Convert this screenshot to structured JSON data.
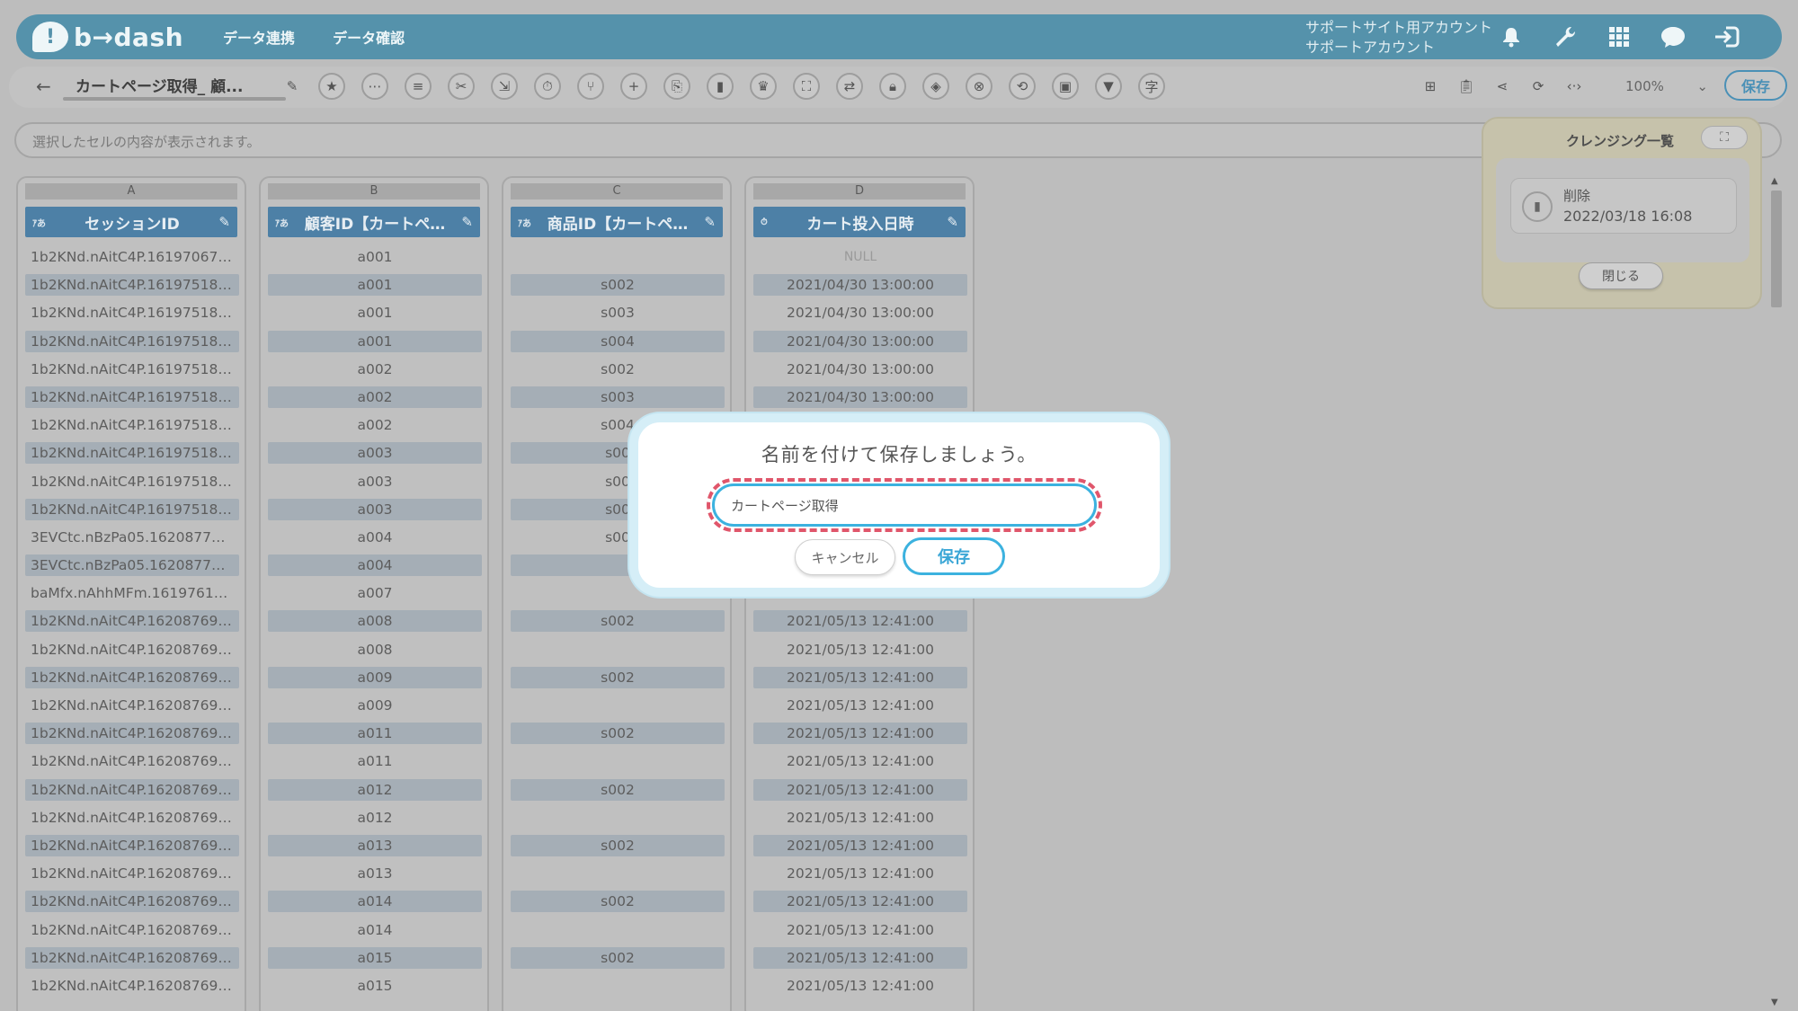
{
  "header": {
    "logo_text": "b→dash",
    "nav": [
      "データ連携",
      "データ確認"
    ],
    "account_line1": "サポートサイト用アカウント",
    "account_line2": "サポートアカウント",
    "brand_color": "#5592ab"
  },
  "toolbar": {
    "title": "カートページ取得_ 顧...",
    "zoom": "100%",
    "save_label": "保存"
  },
  "cell_bar": {
    "placeholder": "選択したセルの内容が表示されます。"
  },
  "columns": [
    {
      "letter": "A",
      "type": "ｱあ",
      "title": "セッションID",
      "cells": [
        "1b2KNd.nAitC4P.161970677...",
        "1b2KNd.nAitC4P.161975180...",
        "1b2KNd.nAitC4P.161975180...",
        "1b2KNd.nAitC4P.161975180...",
        "1b2KNd.nAitC4P.161975180...",
        "1b2KNd.nAitC4P.161975180...",
        "1b2KNd.nAitC4P.161975180...",
        "1b2KNd.nAitC4P.161975180...",
        "1b2KNd.nAitC4P.161975180...",
        "1b2KNd.nAitC4P.161975180...",
        "3EVCtc.nBzPa05.162087702...",
        "3EVCtc.nBzPa05.162087702...",
        "baMfx.nAhhMFm.161976133...",
        "1b2KNd.nAitC4P.162087690...",
        "1b2KNd.nAitC4P.162087690...",
        "1b2KNd.nAitC4P.162087690...",
        "1b2KNd.nAitC4P.162087690...",
        "1b2KNd.nAitC4P.162087690...",
        "1b2KNd.nAitC4P.162087690...",
        "1b2KNd.nAitC4P.162087690...",
        "1b2KNd.nAitC4P.162087690...",
        "1b2KNd.nAitC4P.162087690...",
        "1b2KNd.nAitC4P.162087690...",
        "1b2KNd.nAitC4P.162087690...",
        "1b2KNd.nAitC4P.162087690...",
        "1b2KNd.nAitC4P.162087690...",
        "1b2KNd.nAitC4P.162087690..."
      ]
    },
    {
      "letter": "B",
      "type": "ｱあ",
      "title": "顧客ID【カートペ…",
      "cells": [
        "a001",
        "a001",
        "a001",
        "a001",
        "a002",
        "a002",
        "a002",
        "a003",
        "a003",
        "a003",
        "a004",
        "a004",
        "a007",
        "a008",
        "a008",
        "a009",
        "a009",
        "a011",
        "a011",
        "a012",
        "a012",
        "a013",
        "a013",
        "a014",
        "a014",
        "a015",
        "a015"
      ]
    },
    {
      "letter": "C",
      "type": "ｱあ",
      "title": "商品ID【カートペ…",
      "cells": [
        "",
        "s002",
        "s003",
        "s004",
        "s002",
        "s003",
        "s004",
        "s00",
        "s00",
        "s00",
        "s00",
        "",
        "",
        "s002",
        "",
        "s002",
        "",
        "s002",
        "",
        "s002",
        "",
        "s002",
        "",
        "s002",
        "",
        "s002",
        ""
      ]
    },
    {
      "letter": "D",
      "type": "⏱",
      "title": "カート投入日時",
      "cells": [
        "NULL",
        "2021/04/30 13:00:00",
        "2021/04/30 13:00:00",
        "2021/04/30 13:00:00",
        "2021/04/30 13:00:00",
        "2021/04/30 13:00:00",
        "",
        "",
        "",
        "",
        "",
        "",
        "",
        "2021/05/13 12:41:00",
        "2021/05/13 12:41:00",
        "2021/05/13 12:41:00",
        "2021/05/13 12:41:00",
        "2021/05/13 12:41:00",
        "2021/05/13 12:41:00",
        "2021/05/13 12:41:00",
        "2021/05/13 12:41:00",
        "2021/05/13 12:41:00",
        "2021/05/13 12:41:00",
        "2021/05/13 12:41:00",
        "2021/05/13 12:41:00",
        "2021/05/13 12:41:00",
        "2021/05/13 12:41:00"
      ]
    }
  ],
  "cleansing": {
    "title": "クレンジング一覧",
    "item_name": "削除",
    "item_date": "2022/03/18 16:08",
    "close_label": "閉じる"
  },
  "modal": {
    "title": "名前を付けて保存しましょう。",
    "input_value": "カートページ取得",
    "cancel_label": "キャンセル",
    "save_label": "保存",
    "highlight_color": "#e0566b",
    "accent_color": "#3cb2df"
  }
}
